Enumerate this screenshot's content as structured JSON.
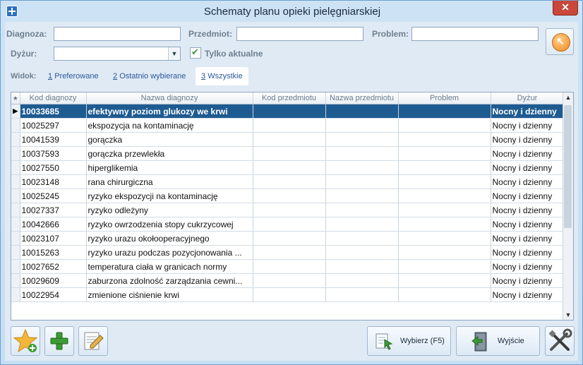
{
  "window": {
    "title": "Schematy planu opieki pielęgniarskiej",
    "close_label": "✕"
  },
  "filters": {
    "diagnoza_label": "Diagnoza:",
    "diagnoza_value": "",
    "przedmiot_label": "Przedmiot:",
    "przedmiot_value": "",
    "problem_label": "Problem:",
    "problem_value": "",
    "dyzur_label": "Dyżur:",
    "dyzur_value": "",
    "tylko_aktualne_label": "Tylko aktualne",
    "tylko_aktualne_checked": true
  },
  "view": {
    "label": "Widok:",
    "tabs": [
      {
        "key": "1",
        "label": "Preferowane"
      },
      {
        "key": "2",
        "label": "Ostatnio wybierane"
      },
      {
        "key": "3",
        "label": "Wszystkie"
      }
    ],
    "active_tab": "3"
  },
  "grid": {
    "columns": [
      "Kod diagnozy",
      "Nazwa diagnozy",
      "Kod przedmiotu",
      "Nazwa przedmiotu",
      "Problem",
      "Dyżur"
    ],
    "rows": [
      [
        "10033685",
        "efektywny poziom glukozy we krwi",
        "",
        "",
        "",
        "Nocny i dzienny"
      ],
      [
        "10025297",
        "ekspozycja na kontaminację",
        "",
        "",
        "",
        "Nocny i dzienny"
      ],
      [
        "10041539",
        "gorączka",
        "",
        "",
        "",
        "Nocny i dzienny"
      ],
      [
        "10037593",
        "gorączka przewlekła",
        "",
        "",
        "",
        "Nocny i dzienny"
      ],
      [
        "10027550",
        "hiperglikemia",
        "",
        "",
        "",
        "Nocny i dzienny"
      ],
      [
        "10023148",
        "rana chirurgiczna",
        "",
        "",
        "",
        "Nocny i dzienny"
      ],
      [
        "10025245",
        "ryzyko ekspozycji na kontaminację",
        "",
        "",
        "",
        "Nocny i dzienny"
      ],
      [
        "10027337",
        "ryzyko odleżyny",
        "",
        "",
        "",
        "Nocny i dzienny"
      ],
      [
        "10042666",
        "ryzyko owrzodzenia stopy cukrzycowej",
        "",
        "",
        "",
        "Nocny i dzienny"
      ],
      [
        "10023107",
        "ryzyko urazu okołooperacyjnego",
        "",
        "",
        "",
        "Nocny i dzienny"
      ],
      [
        "10015263",
        "ryzyko urazu podczas pozycjonowania ...",
        "",
        "",
        "",
        "Nocny i dzienny"
      ],
      [
        "10027652",
        "temperatura ciała w granicach normy",
        "",
        "",
        "",
        "Nocny i dzienny"
      ],
      [
        "10029609",
        "zaburzona zdolność zarządzania cewni...",
        "",
        "",
        "",
        "Nocny i dzienny"
      ],
      [
        "10022954",
        "zmienione ciśnienie krwi",
        "",
        "",
        "",
        "Nocny i dzienny"
      ]
    ],
    "selected_row": 0
  },
  "footer": {
    "wybierz_label": "Wybierz (F5)",
    "wyjscie_label": "Wyjście"
  }
}
